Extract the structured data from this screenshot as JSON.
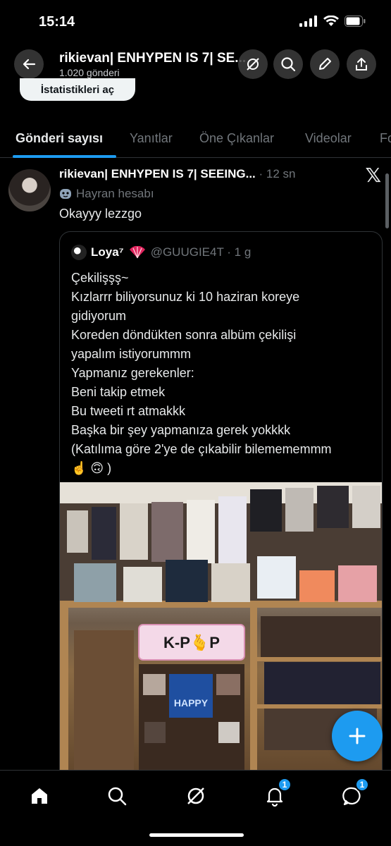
{
  "status_bar": {
    "time": "15:14"
  },
  "header": {
    "title": "rikievan| ENHYPEN IS 7| SE...",
    "subtitle": "1.020 gönderi",
    "stats_button": "İstatistikleri aç"
  },
  "tabs": [
    {
      "label": "Gönderi sayısı",
      "active": true
    },
    {
      "label": "Yanıtlar"
    },
    {
      "label": "Öne Çıkanlar"
    },
    {
      "label": "Videolar"
    },
    {
      "label": "Fo"
    }
  ],
  "tweet": {
    "author_name": "rikievan| ENHYPEN IS 7| SEEING...",
    "time": "· 12 sn",
    "fan_label": "Hayran hesabı",
    "text": "Okayyy lezzgo"
  },
  "quote": {
    "name": "Loya⁷",
    "handle": "@GUUGIE4T · 1 g",
    "lines": [
      "Çekilişşş~",
      "Kızlarrr biliyorsunuz ki 10 haziran koreye",
      "gidiyorum",
      "Koreden döndükten sonra albüm çekilişi",
      "yapalım istiyorummm",
      "Yapmanız gerekenler:",
      "Beni takip etmek",
      "Bu tweeti rt atmakkk",
      "Başka bir şey yapmanıza gerek yokkkk",
      "(Katılıma göre 2'ye de çıkabilir bilemememmm",
      "☝️ 🙃 )"
    ],
    "media_sign": "K-P🫰P",
    "media_text": "HAPPY"
  },
  "bottom_nav": {
    "notifications_badge": "1",
    "messages_badge": "1"
  },
  "colors": {
    "accent": "#1d9bf0",
    "background": "#000000",
    "muted": "#71767b"
  }
}
